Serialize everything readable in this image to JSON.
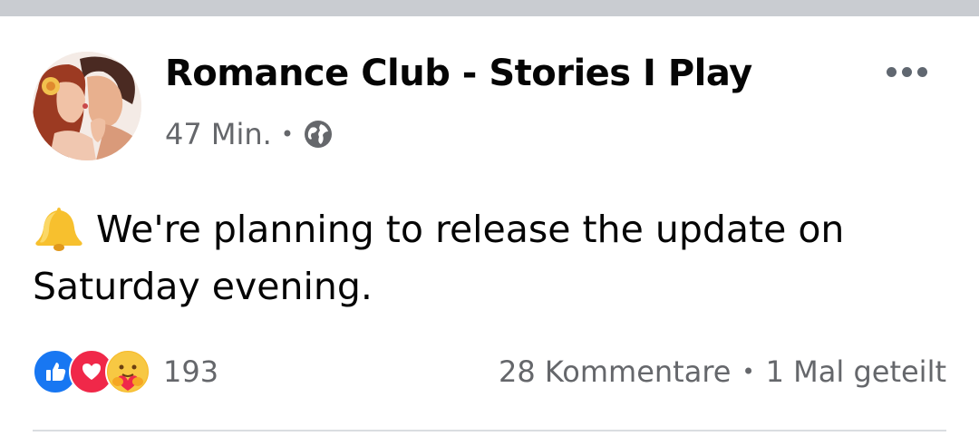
{
  "post": {
    "page_name": "Romance Club - Stories I Play",
    "time_ago": "47 Min.",
    "separator": "•",
    "audience_icon": "globe-icon",
    "menu_icon": "more-options-icon",
    "leading_emoji": "bell",
    "text": "We're planning to release the update on Saturday evening."
  },
  "engagement": {
    "reaction_icons": [
      "like-icon",
      "love-icon",
      "care-icon"
    ],
    "reaction_count": "193",
    "comments": "28 Kommentare",
    "separator": "•",
    "shares": "1 Mal geteilt"
  },
  "colors": {
    "like_blue": "#1877f2",
    "love_red": "#f02849",
    "care_yellow": "#f7b928",
    "secondary_text": "#65676b",
    "top_bar": "#c9ccd1"
  }
}
